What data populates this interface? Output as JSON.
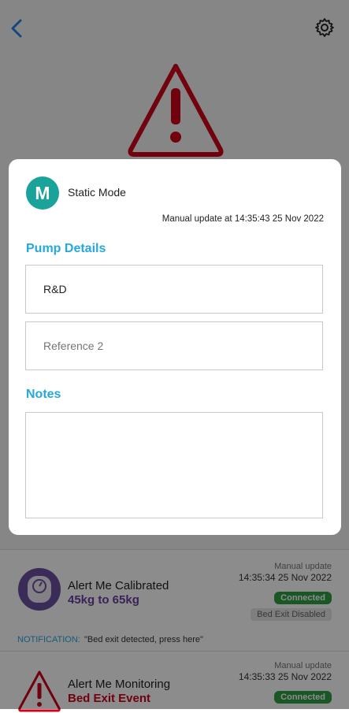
{
  "background": {
    "cards": [
      {
        "title": "Alert Me Calibrated",
        "subtitle": "45kg to 65kg",
        "subtitle_color": "#6b3fa0",
        "manual_label": "Manual update",
        "time": "14:35:34 25 Nov 2022",
        "status": "Connected",
        "extra_status": "Bed Exit Disabled",
        "icon": "scale-icon"
      },
      {
        "title": "Alert Me Monitoring",
        "subtitle": "Bed Exit Event",
        "subtitle_color": "#d0021b",
        "manual_label": "Manual update",
        "time": "14:35:33 25 Nov 2022",
        "status": "Connected",
        "icon": "warning-icon"
      }
    ],
    "notification": {
      "prefix": "NOTIFICATION:",
      "message": "\"Bed exit detected, press here\""
    }
  },
  "modal": {
    "avatar_letter": "M",
    "mode": "Static Mode",
    "manual_update": "Manual update at 14:35:43 25 Nov 2022",
    "pump_section": "Pump Details",
    "pump_field1_value": "R&D",
    "pump_field2_placeholder": "Reference 2",
    "notes_section": "Notes",
    "notes_value": ""
  },
  "colors": {
    "accent_blue": "#25a8db",
    "teal": "#1aa39a",
    "alert_red": "#d0021b",
    "connected_green": "#2e9e44",
    "calibrated_purple": "#6b3fa0"
  }
}
